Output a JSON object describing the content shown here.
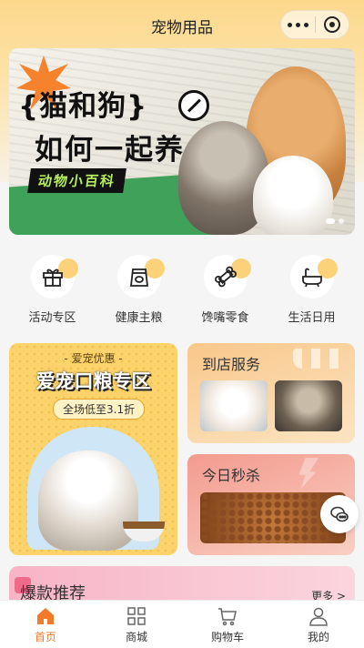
{
  "header": {
    "title": "宠物用品"
  },
  "banner": {
    "line1": "{猫和狗}",
    "line2": "如何一起养",
    "tag": "动物小百科"
  },
  "categories": [
    {
      "label": "活动专区",
      "icon": "gift-icon"
    },
    {
      "label": "健康主粮",
      "icon": "food-bag-icon"
    },
    {
      "label": "馋嘴零食",
      "icon": "bone-icon"
    },
    {
      "label": "生活日用",
      "icon": "bathtub-icon"
    }
  ],
  "promo_left": {
    "small": "- 爱宠优惠 -",
    "big": "爱宠口粮专区",
    "pill": "全场低至3.1折"
  },
  "promo_store": {
    "title": "到店服务"
  },
  "promo_flash": {
    "title": "今日秒杀"
  },
  "hot": {
    "title": "爆款推荐",
    "more": "更多 >"
  },
  "tabs": [
    {
      "label": "首页",
      "icon": "home-icon",
      "active": true
    },
    {
      "label": "商城",
      "icon": "grid-icon",
      "active": false
    },
    {
      "label": "购物车",
      "icon": "cart-icon",
      "active": false
    },
    {
      "label": "我的",
      "icon": "user-icon",
      "active": false
    }
  ],
  "colors": {
    "accent": "#f47a2a",
    "header": "#fcd88c"
  }
}
